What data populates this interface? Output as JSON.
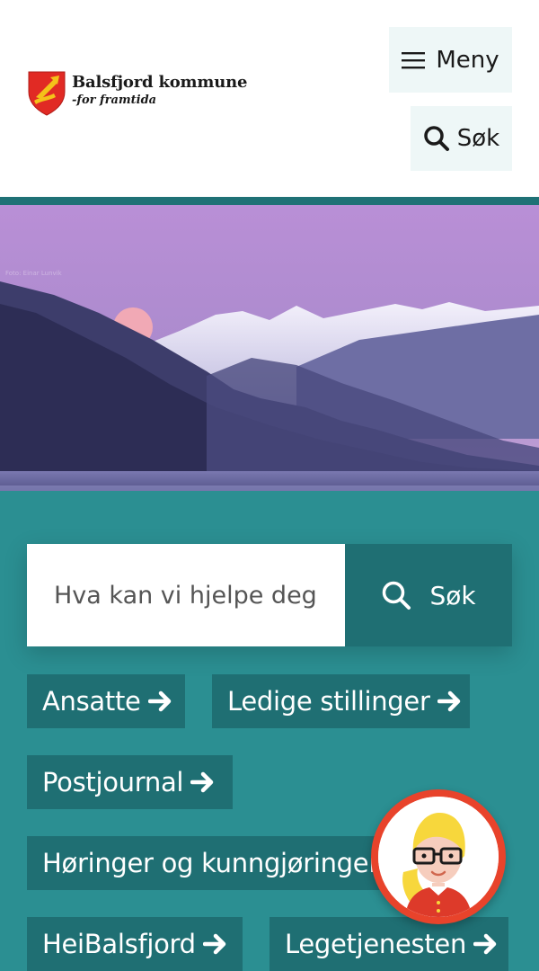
{
  "header": {
    "logo_name": "Balsfjord kommune",
    "logo_tagline": "-for framtida",
    "menu_label": "Meny",
    "search_label": "Søk"
  },
  "hero": {
    "photo_credit": "Foto: Einar Lunvik"
  },
  "search": {
    "placeholder": "Hva kan vi hjelpe deg med?",
    "button_label": "Søk"
  },
  "quick_links": [
    {
      "label": "Ansatte"
    },
    {
      "label": "Ledige stillinger"
    },
    {
      "label": "Postjournal"
    },
    {
      "label": "Høringer og kunngjøringer"
    },
    {
      "label": "HeiBalsfjord"
    },
    {
      "label": "Legetjenesten"
    }
  ],
  "colors": {
    "accent": "#2b8f92",
    "dark_teal": "#1f6f73",
    "chatbot_ring": "#e8432b"
  },
  "icons": [
    "shield-logo-icon",
    "hamburger-icon",
    "search-icon",
    "arrow-right-icon",
    "chatbot-avatar-icon"
  ]
}
